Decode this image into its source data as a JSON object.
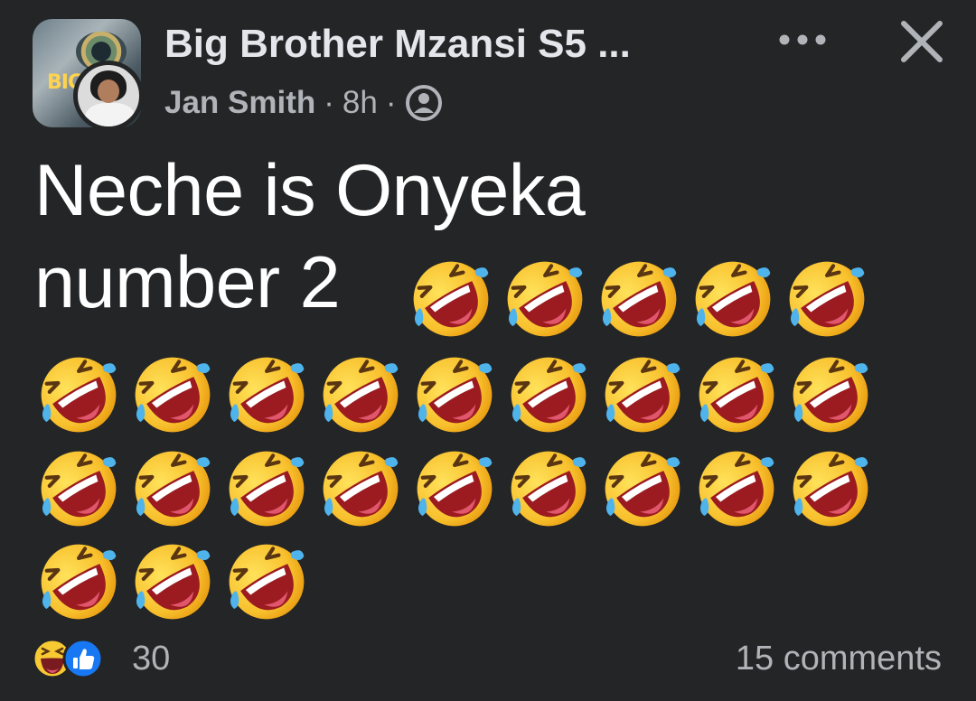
{
  "post": {
    "group_name": "Big Brother Mzansi S5 ...",
    "author": "Jan Smith",
    "separator": "·",
    "time": "8h",
    "privacy_icon": "members-icon",
    "more_icon": "more-horizontal-icon",
    "close_icon": "close-icon",
    "group_logo_text": "BIG NA",
    "text_line1": "Neche is Onyeka",
    "text_line2": "number 2",
    "emoji_name": "rolling-on-the-floor-laughing-emoji",
    "emoji_count": 26
  },
  "reactions": {
    "icons": [
      "haha-reaction-icon",
      "like-reaction-icon"
    ],
    "count": "30",
    "comments": "15 comments"
  },
  "colors": {
    "background": "#242526",
    "primary_text": "#ffffff",
    "secondary_text": "#b0b3b8",
    "like_blue": "#1877f2",
    "emoji_yellow": "#ffcc33"
  }
}
